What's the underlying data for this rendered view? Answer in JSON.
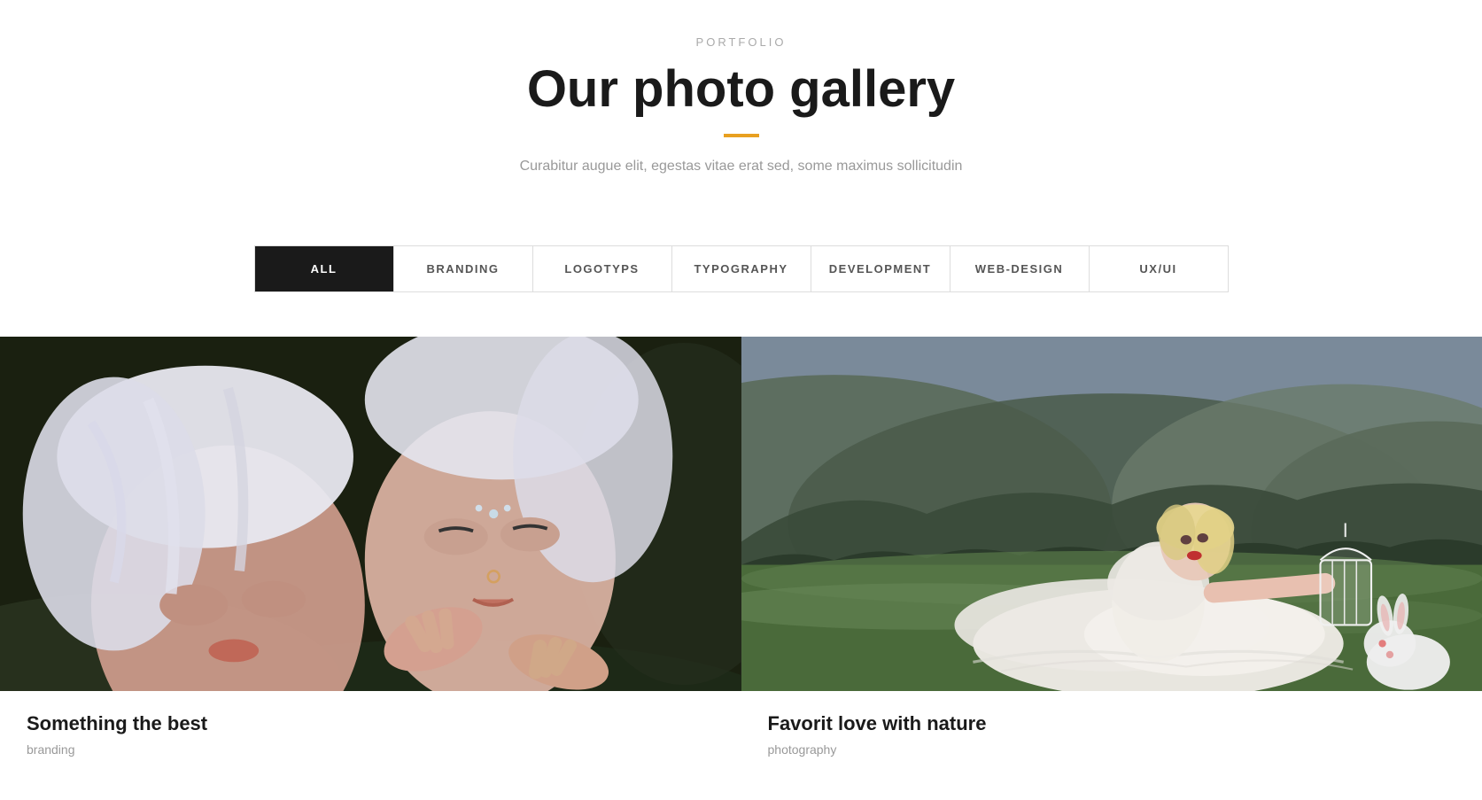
{
  "header": {
    "portfolio_label": "PORTFOLIO",
    "gallery_title": "Our photo gallery",
    "subtitle": "Curabitur augue elit, egestas vitae erat sed, some maximus sollicitudin",
    "accent_color": "#e8a020"
  },
  "filter_tabs": [
    {
      "id": "all",
      "label": "ALL",
      "active": true
    },
    {
      "id": "branding",
      "label": "BRANDING",
      "active": false
    },
    {
      "id": "logotyps",
      "label": "LOGOTYPS",
      "active": false
    },
    {
      "id": "typography",
      "label": "TYPOGRAPHY",
      "active": false
    },
    {
      "id": "development",
      "label": "DEVELOPMENT",
      "active": false
    },
    {
      "id": "web-design",
      "label": "WEB-DESIGN",
      "active": false
    },
    {
      "id": "ux-ui",
      "label": "UX/UI",
      "active": false
    }
  ],
  "gallery_items": [
    {
      "id": "item-1",
      "title": "Something the best",
      "category": "branding",
      "alt": "Two women with white hair lying on grass"
    },
    {
      "id": "item-2",
      "title": "Favorit love with nature",
      "category": "photography",
      "alt": "Woman in white dress lying on hillside with rabbit"
    }
  ]
}
